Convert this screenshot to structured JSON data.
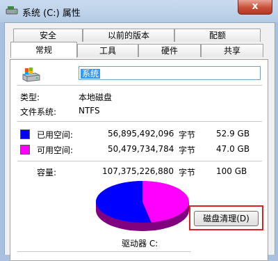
{
  "window": {
    "title": "系统 (C:) 属性",
    "close_label": "x"
  },
  "tabs": {
    "row1": [
      "安全",
      "以前的版本",
      "配额"
    ],
    "row2": [
      "常规",
      "工具",
      "硬件",
      "共享"
    ],
    "selected": "常规"
  },
  "general": {
    "volume_name": "系统",
    "type_label": "类型:",
    "type_value": "本地磁盘",
    "fs_label": "文件系统:",
    "fs_value": "NTFS",
    "used": {
      "label": "已用空间:",
      "bytes": "56,895,492,096",
      "unit": "字节",
      "size": "52.9 GB",
      "color": "#0000ff"
    },
    "free": {
      "label": "可用空间:",
      "bytes": "50,479,734,784",
      "unit": "字节",
      "size": "47.0 GB",
      "color": "#ff00ff"
    },
    "capacity": {
      "label": "容量:",
      "bytes": "107,375,226,880",
      "unit": "字节",
      "size": "100 GB"
    },
    "drive_label": "驱动器 C:",
    "cleanup_label": "磁盘清理(D)",
    "used_fraction": 0.53
  }
}
